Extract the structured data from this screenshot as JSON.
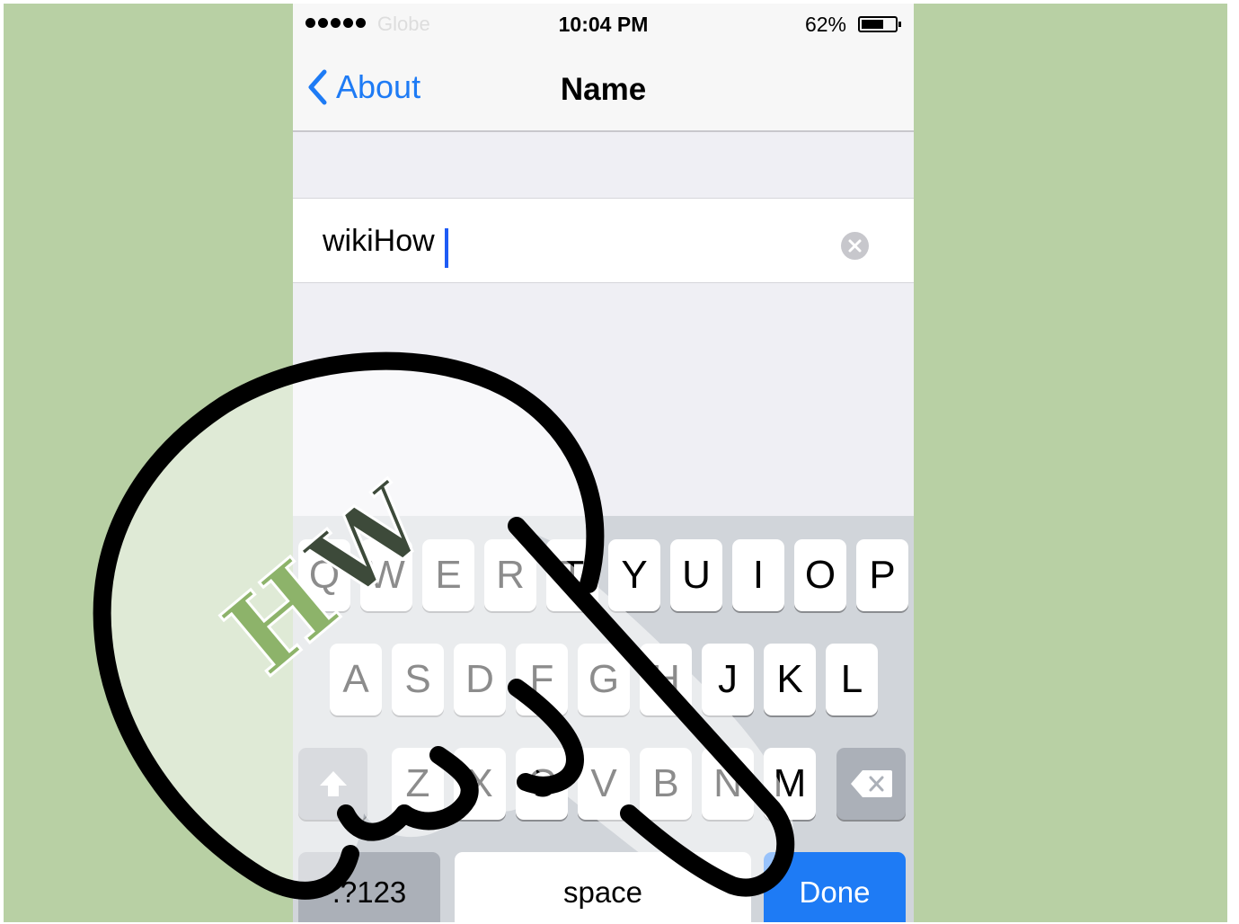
{
  "status_bar": {
    "carrier": "Globe",
    "time": "10:04 PM",
    "battery_percent": "62%",
    "battery_level": 0.62
  },
  "nav": {
    "back_label": "About",
    "title": "Name"
  },
  "name_field": {
    "value": "wikiHow"
  },
  "keyboard": {
    "row1": [
      "Q",
      "W",
      "E",
      "R",
      "T",
      "Y",
      "U",
      "I",
      "O",
      "P"
    ],
    "row2": [
      "A",
      "S",
      "D",
      "F",
      "G",
      "H",
      "J",
      "K",
      "L"
    ],
    "row3": [
      "Z",
      "X",
      "C",
      "V",
      "B",
      "N",
      "M"
    ],
    "numbers_label": ".?123",
    "space_label": "space",
    "done_label": "Done"
  },
  "icons": {
    "back": "chevron-left-icon",
    "clear": "clear-x-icon",
    "shift": "shift-arrow-icon",
    "delete": "backspace-icon"
  },
  "colors": {
    "background": "#b8d0a4",
    "accent": "#1e7bf5",
    "keyboard": "#d1d5da"
  }
}
